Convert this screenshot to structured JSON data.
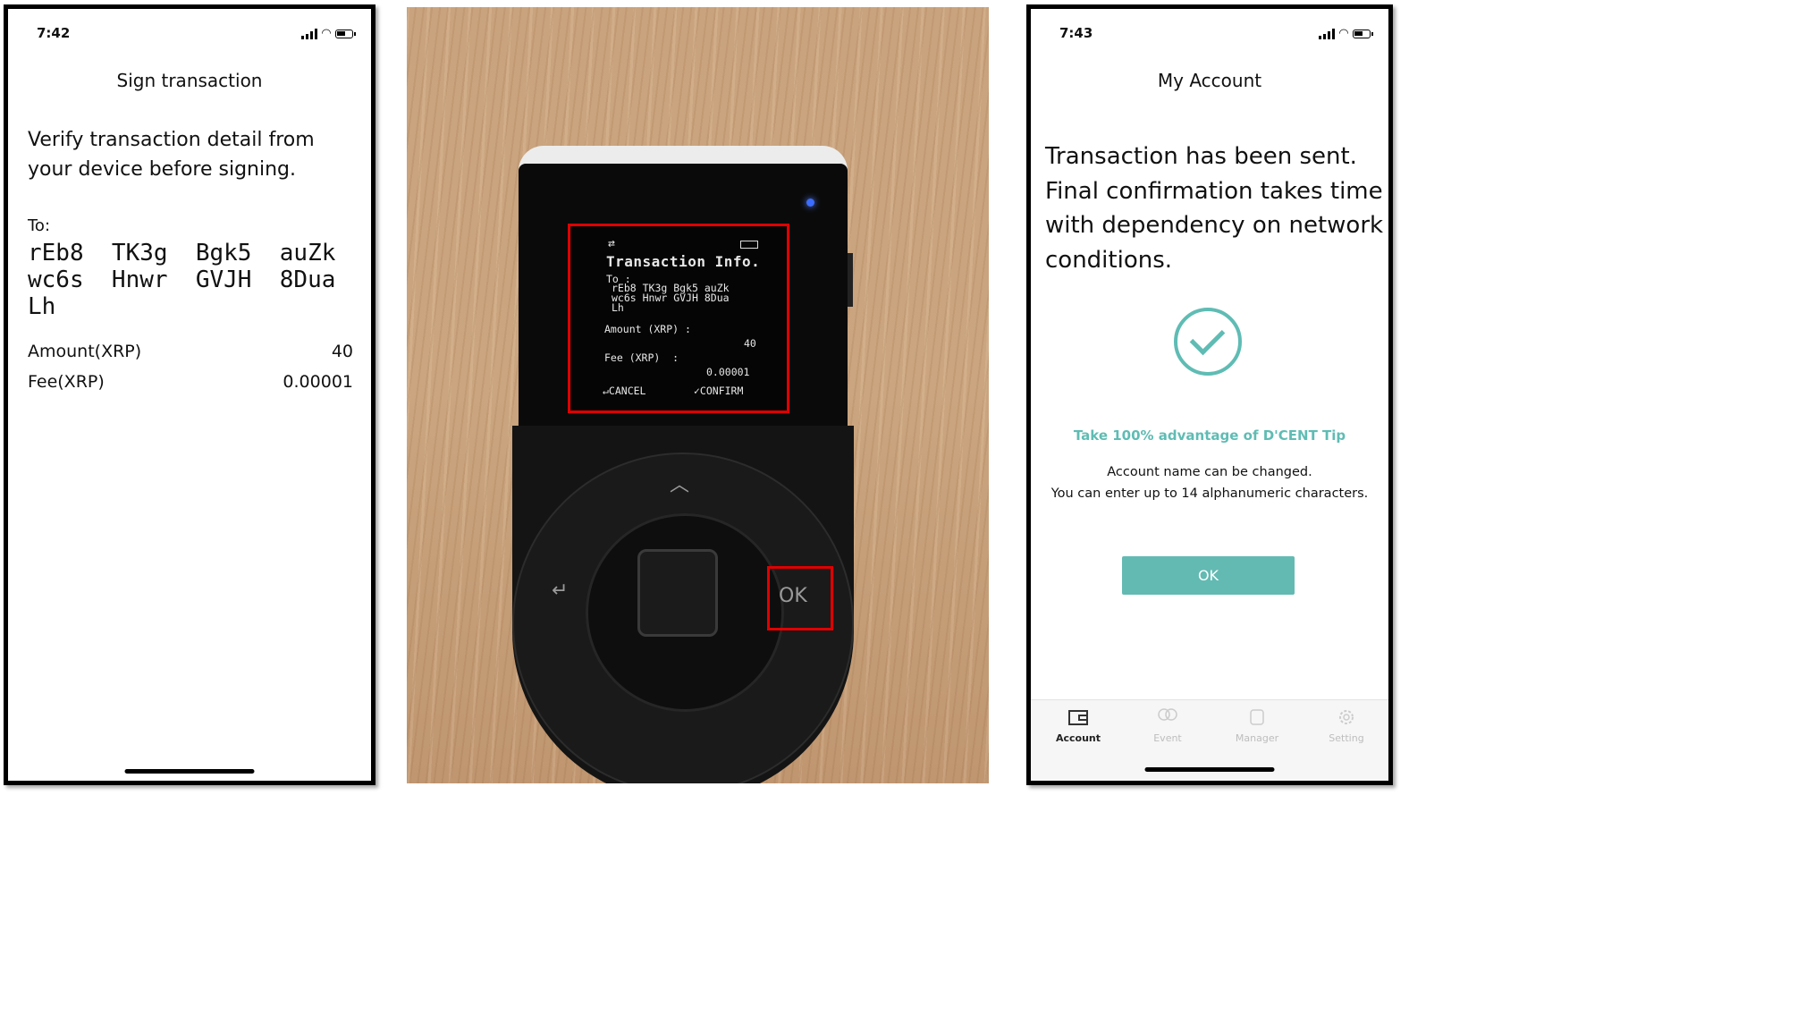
{
  "left_phone": {
    "time": "7:42",
    "header": "Sign transaction",
    "verify_text": "Verify transaction detail from your device before signing.",
    "to_label": "To:",
    "address_lines": [
      "rEb8  TK3g  Bgk5  auZk",
      "wc6s  Hnwr  GVJH  8Dua",
      "Lh"
    ],
    "amount_label": "Amount(XRP)",
    "amount_value": "40",
    "fee_label": "Fee(XRP)",
    "fee_value": "0.00001"
  },
  "device": {
    "screen_title": "Transaction Info.",
    "to_label": "To :",
    "address_lines": [
      "rEb8 TK3g Bgk5 auZk",
      "wc6s Hnwr GVJH 8Dua",
      "Lh"
    ],
    "amount_label": "Amount (XRP) :",
    "amount_value": "40",
    "fee_label": "Fee (XRP)  :",
    "fee_value": "0.00001",
    "cancel_label": "↵CANCEL",
    "confirm_label": "✓CONFIRM",
    "ok_label": "OK",
    "highlight_color": "#e00000"
  },
  "right_phone": {
    "time": "7:43",
    "header": "My Account",
    "message": "Transaction has been sent. Final confirmation takes time with dependency on network conditions.",
    "tip": "Take 100% advantage of D'CENT Tip",
    "info_line1": "Account name can be changed.",
    "info_line2": "You can enter up to 14 alphanumeric characters.",
    "ok_button": "OK",
    "accent_color": "#5fbcb4",
    "tabs": [
      {
        "label": "Account",
        "icon": "wallet-icon",
        "active": true
      },
      {
        "label": "Event",
        "icon": "balloon-icon",
        "active": false
      },
      {
        "label": "Manager",
        "icon": "device-icon",
        "active": false
      },
      {
        "label": "Setting",
        "icon": "gear-icon",
        "active": false
      }
    ]
  }
}
